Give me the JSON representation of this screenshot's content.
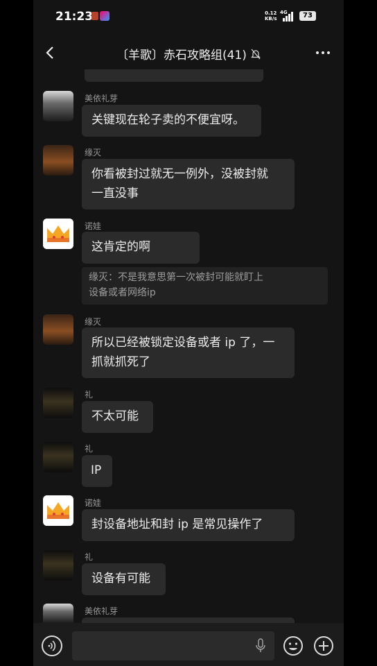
{
  "status": {
    "time": "21:23",
    "net_speed": "0.12",
    "net_unit": "KB/s",
    "net_type": "4G",
    "battery": "73"
  },
  "header": {
    "title": "〔羊歌〕赤石攻略组(41)"
  },
  "messages": [
    {
      "sender": "美依礼芽",
      "text": "关键现在轮子卖的不便宜呀。"
    },
    {
      "sender": "缘灭",
      "lines": [
        "你看被封过就无一例外，没被封就",
        "一直没事"
      ]
    },
    {
      "sender": "诺娃",
      "text": "这肯定的啊",
      "quote_lines": [
        "缘灭：不是我意思第一次被封可能就盯上",
        "设备或者网络ip"
      ]
    },
    {
      "sender": "缘灭",
      "lines": [
        "所以已经被锁定设备或者 ip 了，一",
        "抓就抓死了"
      ]
    },
    {
      "sender": "礼",
      "text": "不太可能"
    },
    {
      "sender": "礼",
      "text": "IP"
    },
    {
      "sender": "诺娃",
      "text": "封设备地址和封 ip 是常见操作了"
    },
    {
      "sender": "礼",
      "text": "设备有可能"
    },
    {
      "sender": "美依礼芽"
    }
  ],
  "icons": {
    "back": "chevron-left-icon",
    "bell": "bell-muted-icon",
    "more": "more-dots-icon",
    "voice": "voice-icon",
    "mic": "microphone-icon",
    "emoji": "emoji-icon",
    "plus": "plus-icon"
  },
  "colors": {
    "background": "#141414",
    "bubble": "#2b2b2b",
    "quote": "#222222",
    "name": "#9a9a9a"
  }
}
